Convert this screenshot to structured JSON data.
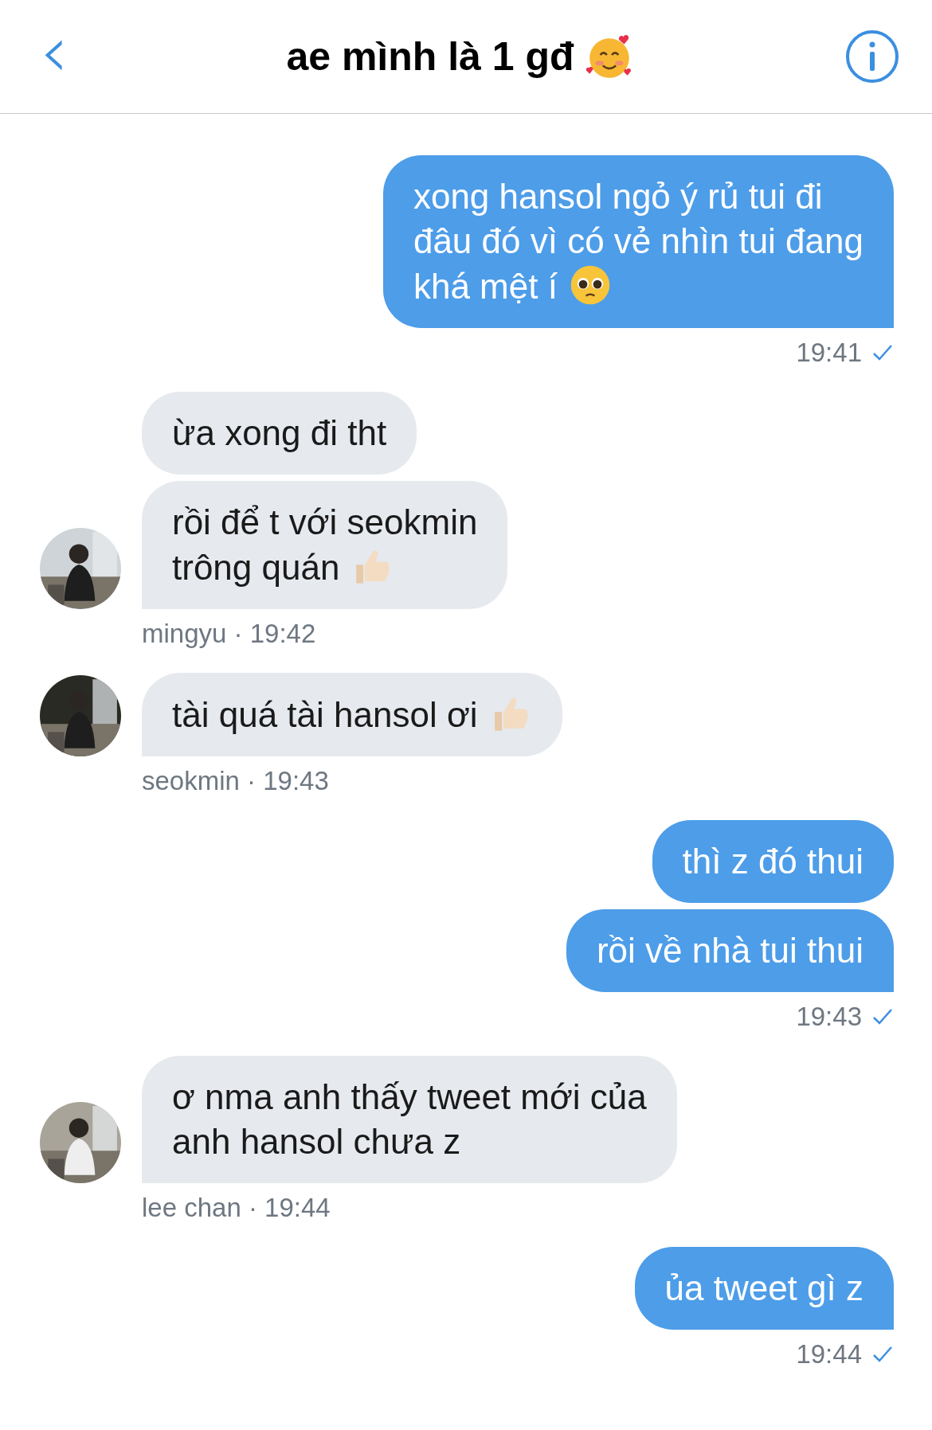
{
  "header": {
    "back": "‹",
    "title": "ae mình là 1 gđ",
    "title_emoji": {
      "kind": "hearts-face"
    }
  },
  "groups": [
    {
      "kind": "outgoing",
      "bubbles": [
        {
          "text": "xong hansol ngỏ ý rủ tui đi\nđâu đó vì có vẻ nhìn tui đang\nkhá mệt í",
          "emoji": {
            "kind": "pleading-face"
          }
        }
      ],
      "meta": "19:41",
      "read": true
    },
    {
      "kind": "incoming",
      "avatar": {
        "kind": "picture"
      },
      "bubbles": [
        {
          "text": "ừa xong đi tht"
        },
        {
          "text": "rồi để t với seokmin\ntrông quán",
          "emoji": {
            "kind": "thumbs-up"
          }
        }
      ],
      "meta": "mingyu · 19:42"
    },
    {
      "kind": "incoming",
      "avatar": {
        "kind": "picture"
      },
      "bubbles": [
        {
          "text": "tài quá tài hansol ơi",
          "emoji": {
            "kind": "thumbs-up"
          }
        }
      ],
      "meta": "seokmin · 19:43"
    },
    {
      "kind": "outgoing",
      "bubbles": [
        {
          "text": "thì z đó thui"
        },
        {
          "text": "rồi về nhà tui thui"
        }
      ],
      "meta": "19:43",
      "read": true
    },
    {
      "kind": "incoming",
      "avatar": {
        "kind": "picture"
      },
      "bubbles": [
        {
          "text": "ơ nma anh thấy tweet mới của\nanh hansol chưa z"
        }
      ],
      "meta": "lee chan · 19:44"
    },
    {
      "kind": "outgoing",
      "bubbles": [
        {
          "text": "ủa tweet gì z"
        }
      ],
      "meta": "19:44",
      "read": true
    }
  ]
}
